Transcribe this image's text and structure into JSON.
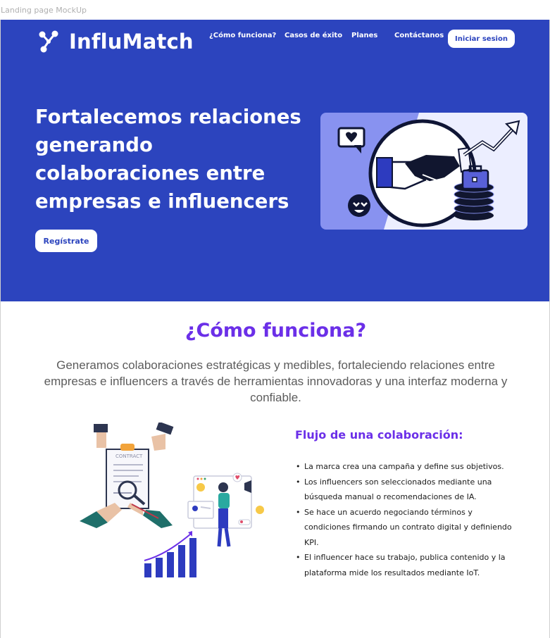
{
  "frame": {
    "label": "Landing page MockUp"
  },
  "header": {
    "brand": "InfluMatch",
    "nav": [
      "¿Cómo funciona?",
      "Casos de éxito",
      "Planes",
      "Contáctanos"
    ],
    "login_label": "Iniciar sesion"
  },
  "hero": {
    "title": "Fortalecemos relaciones generando colaboraciones entre empresas e influencers",
    "cta_label": "Regístrate"
  },
  "how_it_works": {
    "title": "¿Cómo funciona?",
    "description": "Generamos colaboraciones estratégicas y medibles, fortaleciendo relaciones entre empresas e influencers a través de herramientas innovadoras y una interfaz moderna y confiable.",
    "illustration_label": "CONTRACT",
    "flow_title": "Flujo de una colaboración:",
    "steps": [
      "La marca crea una campaña y define sus objetivos.",
      "Los influencers son seleccionados mediante una búsqueda manual o recomendaciones de IA.",
      "Se hace un acuerdo negociando términos y condiciones firmando un contrato digital y definiendo KPI.",
      "El influencer hace su trabajo, publica contenido y la plataforma mide los resultados mediante IoT."
    ]
  },
  "colors": {
    "hero_bg": "#2c44be",
    "accent_purple": "#6b2fe8",
    "illustration_blue": "#2d3bbf"
  }
}
